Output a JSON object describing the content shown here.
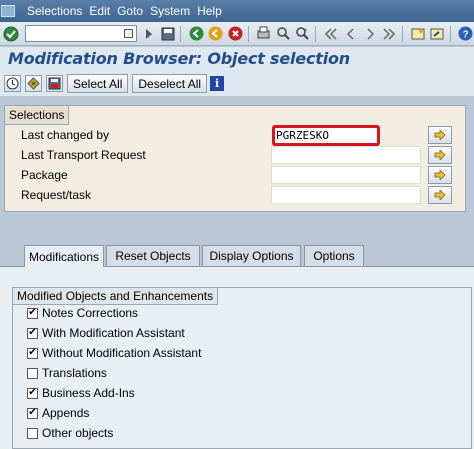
{
  "menu": {
    "items": [
      "Selections",
      "Edit",
      "Goto",
      "System",
      "Help"
    ]
  },
  "toolbar": {
    "command_value": ""
  },
  "title": "Modification Browser: Object selection",
  "app_toolbar": {
    "select_all": "Select All",
    "deselect_all": "Deselect All",
    "info": "i"
  },
  "selections": {
    "title": "Selections",
    "rows": [
      {
        "label": "Last changed by",
        "value": "PGRZESKO"
      },
      {
        "label": "Last Transport Request",
        "value": ""
      },
      {
        "label": "Package",
        "value": ""
      },
      {
        "label": "Request/task",
        "value": ""
      }
    ]
  },
  "tabs": [
    "Modifications",
    "Reset Objects",
    "Display Options",
    "Options"
  ],
  "active_tab": "Modifications",
  "group": {
    "title": "Modified Objects and Enhancements",
    "items": [
      {
        "label": "Notes Corrections",
        "checked": true
      },
      {
        "label": "With Modification Assistant",
        "checked": true
      },
      {
        "label": "Without Modification Assistant",
        "checked": true
      },
      {
        "label": "Translations",
        "checked": false
      },
      {
        "label": "Business Add-Ins",
        "checked": true
      },
      {
        "label": "Appends",
        "checked": true
      },
      {
        "label": "Other objects",
        "checked": false
      }
    ]
  },
  "colors": {
    "highlight_border": "#d6171f",
    "title_text": "#234e8a",
    "menubar": "#3e6591"
  }
}
